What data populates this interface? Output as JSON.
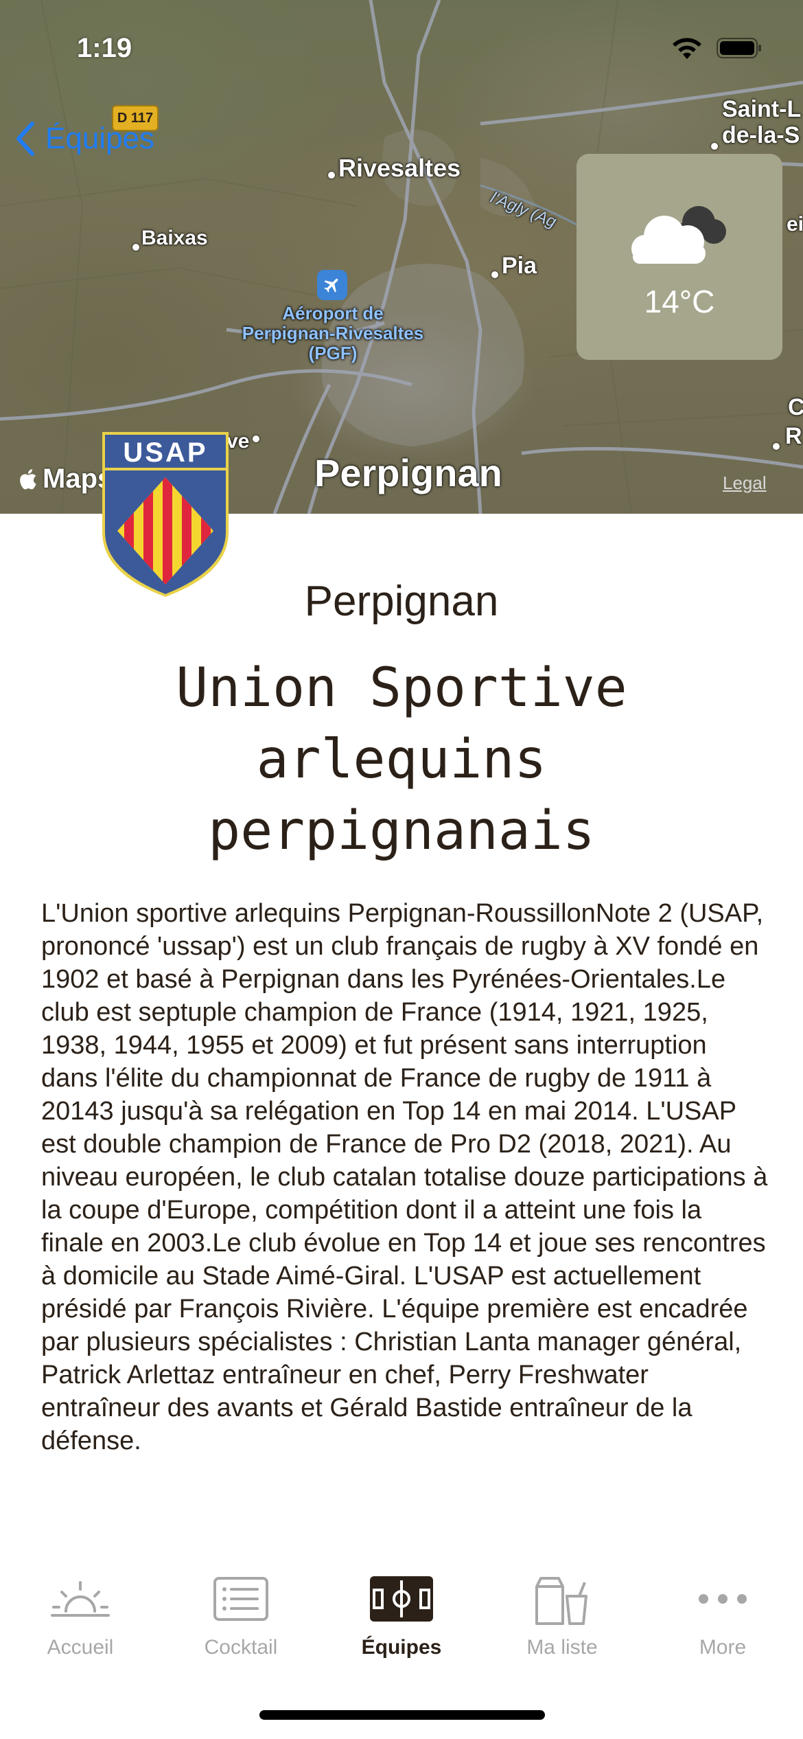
{
  "status_bar": {
    "time": "1:19"
  },
  "nav": {
    "back_label": "Équipes"
  },
  "map": {
    "road_badge": "D 117",
    "places": [
      "Rivesaltes",
      "Baixas",
      "Pia",
      "Perpignan",
      "Saint-L",
      "de-la-S",
      "C",
      "R",
      "ei",
      "ve"
    ],
    "airport": "Aéroport de Perpignan-Rivesaltes (PGF)",
    "river": "l'Agly (Ag",
    "attribution": "Maps",
    "legal": "Legal"
  },
  "weather": {
    "temperature": "14°C",
    "icon": "partly-cloudy-icon"
  },
  "club": {
    "crest_text": "USAP",
    "city": "Perpignan",
    "name": "Union Sportive arlequins perpignanais",
    "description": "L'Union sportive arlequins Perpignan-RoussillonNote 2 (USAP, prononcé 'ussap') est un club français de rugby à XV fondé en 1902 et basé à Perpignan dans les Pyrénées-Orientales.Le club est septuple champion de France (1914, 1921, 1925, 1938, 1944, 1955 et 2009) et fut présent sans interruption dans l'élite du championnat de France de rugby de 1911 à 20143 jusqu'à sa relégation en Top 14 en mai 2014. L'USAP est double champion de France de Pro D2 (2018, 2021). Au niveau européen, le club catalan totalise douze participations à la coupe d'Europe, compétition dont il a atteint une fois la finale en 2003.Le club évolue en Top 14 et joue ses rencontres à domicile au Stade Aimé-Giral. L'USAP est actuellement présidé par François Rivière. L'équipe première est encadrée par plusieurs spécialistes : Christian Lanta manager général, Patrick Arlettaz entraîneur en chef, Perry Freshwater entraîneur des avants et Gérald Bastide entraîneur de la défense."
  },
  "tabs": [
    {
      "label": "Accueil",
      "icon": "sunrise-icon",
      "active": false
    },
    {
      "label": "Cocktail",
      "icon": "list-icon",
      "active": false
    },
    {
      "label": "Équipes",
      "icon": "field-icon",
      "active": true
    },
    {
      "label": "Ma liste",
      "icon": "shopping-bag-icon",
      "active": false
    },
    {
      "label": "More",
      "icon": "more-icon",
      "active": false
    }
  ],
  "colors": {
    "accent": "#1F7CF2",
    "text": "#2B2118",
    "inactive_tab": "#A7A7A7",
    "weather_card": "#A6A68D",
    "crest_blue": "#3C5A9A",
    "crest_red": "#E0263C",
    "crest_yellow": "#F5D630"
  }
}
